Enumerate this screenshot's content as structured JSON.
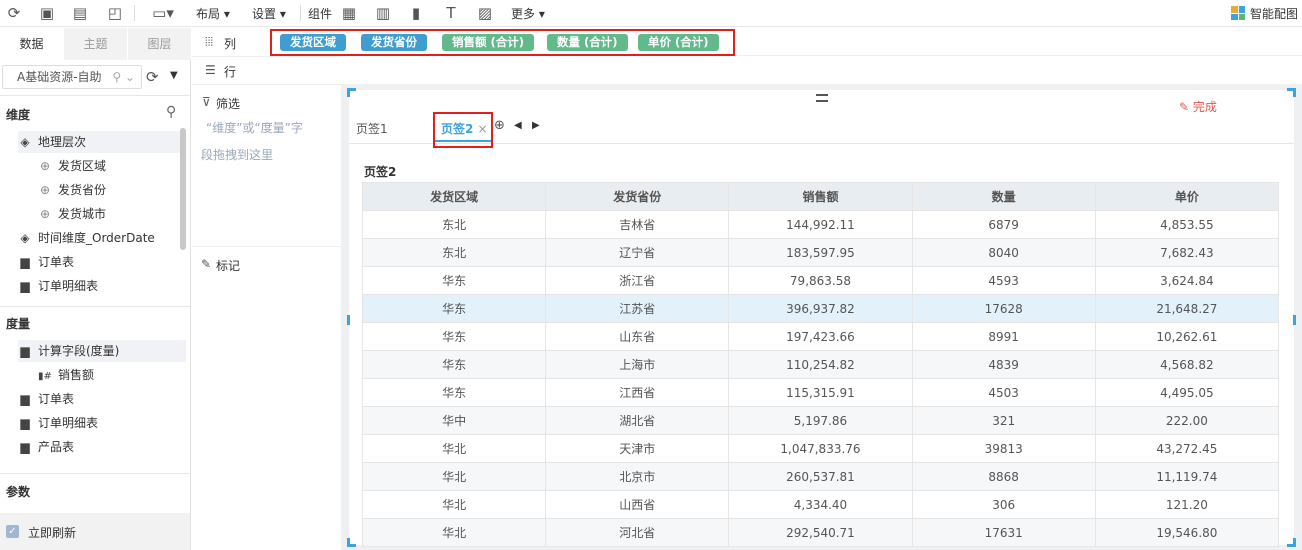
{
  "toolbar": {
    "layout": "布局",
    "settings": "设置",
    "component": "组件",
    "more": "更多",
    "smart": "智能配图"
  },
  "left": {
    "tabs": [
      "数据",
      "主题",
      "图层"
    ],
    "datasource": "A基础资源-自助",
    "dim_header": "维度",
    "dims": [
      "地理层次",
      "发货区域",
      "发货省份",
      "发货城市",
      "时间维度_OrderDate",
      "订单表",
      "订单明细表"
    ],
    "mea_header": "度量",
    "meas": [
      "计算字段(度量)",
      "销售额",
      "订单表",
      "订单明细表",
      "产品表"
    ],
    "param_header": "参数",
    "refresh": "立即刷新"
  },
  "mid": {
    "col_label": "列",
    "row_label": "行",
    "filter_label": "筛选",
    "filter_hint_1": "“维度”或“度量”字",
    "filter_hint_2": "段拖拽到这里",
    "mark_label": "标记"
  },
  "fields": [
    "发货区域",
    "发货省份",
    "销售额 (合计)",
    "数量 (合计)",
    "单价 (合计)"
  ],
  "widget": {
    "done": "完成",
    "tab1": "页签1",
    "tab2": "页签2",
    "title": "页签2",
    "headers": [
      "发货区域",
      "发货省份",
      "销售额",
      "数量",
      "单价"
    ],
    "rows": [
      [
        "东北",
        "吉林省",
        "144,992.11",
        "6879",
        "4,853.55"
      ],
      [
        "东北",
        "辽宁省",
        "183,597.95",
        "8040",
        "7,682.43"
      ],
      [
        "华东",
        "浙江省",
        "79,863.58",
        "4593",
        "3,624.84"
      ],
      [
        "华东",
        "江苏省",
        "396,937.82",
        "17628",
        "21,648.27"
      ],
      [
        "华东",
        "山东省",
        "197,423.66",
        "8991",
        "10,262.61"
      ],
      [
        "华东",
        "上海市",
        "110,254.82",
        "4839",
        "4,568.82"
      ],
      [
        "华东",
        "江西省",
        "115,315.91",
        "4503",
        "4,495.05"
      ],
      [
        "华中",
        "湖北省",
        "5,197.86",
        "321",
        "222.00"
      ],
      [
        "华北",
        "天津市",
        "1,047,833.76",
        "39813",
        "43,272.45"
      ],
      [
        "华北",
        "北京市",
        "260,537.81",
        "8868",
        "11,119.74"
      ],
      [
        "华北",
        "山西省",
        "4,334.40",
        "306",
        "121.20"
      ],
      [
        "华北",
        "河北省",
        "292,540.71",
        "17631",
        "19,546.80"
      ]
    ]
  }
}
